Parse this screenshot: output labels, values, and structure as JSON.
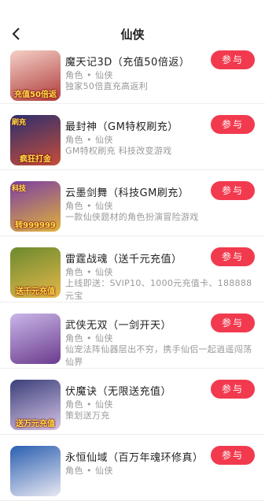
{
  "header": {
    "title": "仙侠"
  },
  "games": [
    {
      "name": "魔天记3D（充值50倍返）",
      "tags": "角色 • 仙侠",
      "desc": "独家50倍直充高返利",
      "button": "参与",
      "badge": "充值50倍返",
      "tag": "",
      "colors": [
        "#f4d0c6",
        "#b03b3b"
      ]
    },
    {
      "name": "最封神（GM特权刷充）",
      "tags": "角色 • 仙侠",
      "desc": "GM特权刷充 科技改变游戏",
      "button": "参与",
      "badge": "疯狂打金",
      "tag": "刷充",
      "colors": [
        "#2b2f6e",
        "#c74d3a"
      ]
    },
    {
      "name": "云墨剑舞（科技GM刷充）",
      "tags": "角色 • 仙侠",
      "desc": "一款仙侠题材的角色扮演冒险游戏",
      "button": "参与",
      "badge": "转999999",
      "tag": "科技",
      "colors": [
        "#7b3fa3",
        "#e1b23a"
      ]
    },
    {
      "name": "雷霆战魂（送千元充值）",
      "tags": "角色 • 仙侠",
      "desc": "上线即送：SVIP10、1000元充值卡、188888元宝",
      "button": "参与",
      "badge": "送千元充值",
      "tag": "",
      "colors": [
        "#6a8a2e",
        "#e7b84a"
      ]
    },
    {
      "name": "武侠无双（一剑开天）",
      "tags": "角色 • 仙侠",
      "desc": "仙宠法阵仙器层出不穷，携手仙侣一起逍遥闯荡仙界",
      "button": "参与",
      "badge": "",
      "tag": "",
      "colors": [
        "#c9b6e8",
        "#6b3c8e"
      ]
    },
    {
      "name": "伏魔诀（无限送充值）",
      "tags": "角色 • 仙侠",
      "desc": "策划送万充",
      "button": "参与",
      "badge": "送万元充值",
      "tag": "",
      "colors": [
        "#3a3f7a",
        "#d6c4e6"
      ]
    },
    {
      "name": "永恒仙域（百万年魂环修真）",
      "tags": "角色 • 仙侠",
      "desc": "",
      "button": "参与",
      "badge": "",
      "tag": "",
      "colors": [
        "#2a5fb0",
        "#e8e8f2"
      ]
    }
  ]
}
